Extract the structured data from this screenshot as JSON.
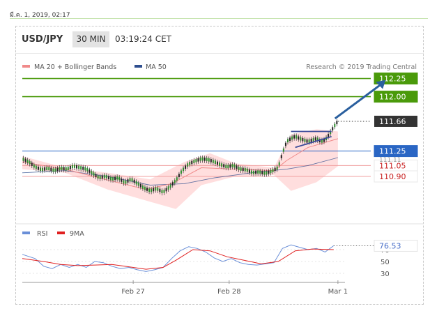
{
  "header": {
    "timestamp": "มี.ค. 1, 2019, 02:17",
    "symbol": "USD/JPY",
    "interval": "30 MIN",
    "time": "03:19:24 CET"
  },
  "legend": {
    "ma20_label": "MA 20 + Bollinger Bands",
    "ma50_label": "MA 50",
    "credit": "Research © 2019 Trading Central",
    "rsi_label": "RSI",
    "ma9_label": "9MA"
  },
  "colors": {
    "ma20": "#f08a8a",
    "ma50": "#2e4e8f",
    "bands": "#ffd8d8",
    "green_level": "#4a9a0a",
    "blue_level": "#2a66c4",
    "red_level": "#f0a0a0",
    "arrow": "#2a5f9e",
    "rsi": "#6a8fd8",
    "ma9": "#e02020"
  },
  "chart_data": [
    {
      "type": "line",
      "name": "price",
      "x_ticks": [
        "Feb 27",
        "Feb 28",
        "Mar 1"
      ],
      "current_price": 111.66,
      "levels": [
        {
          "value": 112.25,
          "label": "112.25",
          "kind": "resistance"
        },
        {
          "value": 112.0,
          "label": "112.00",
          "kind": "resistance"
        },
        {
          "value": 111.25,
          "label": "111.25",
          "kind": "pivot"
        },
        {
          "value": 111.05,
          "label": "111.05",
          "kind": "support"
        },
        {
          "value": 110.9,
          "label": "110.90",
          "kind": "support"
        }
      ],
      "hidden_label": "111.11",
      "price_path": [
        [
          0,
          111.14
        ],
        [
          3,
          111.1
        ],
        [
          6,
          111.03
        ],
        [
          9,
          110.99
        ],
        [
          12,
          111.01
        ],
        [
          15,
          110.98
        ],
        [
          18,
          111.01
        ],
        [
          21,
          111.0
        ],
        [
          24,
          111.04
        ],
        [
          27,
          111.02
        ],
        [
          30,
          111.0
        ],
        [
          33,
          110.94
        ],
        [
          36,
          110.88
        ],
        [
          39,
          110.9
        ],
        [
          42,
          110.86
        ],
        [
          45,
          110.88
        ],
        [
          48,
          110.81
        ],
        [
          51,
          110.86
        ],
        [
          54,
          110.8
        ],
        [
          57,
          110.74
        ],
        [
          60,
          110.7
        ],
        [
          63,
          110.73
        ],
        [
          66,
          110.68
        ],
        [
          69,
          110.75
        ],
        [
          72,
          110.84
        ],
        [
          75,
          110.98
        ],
        [
          78,
          111.07
        ],
        [
          81,
          111.11
        ],
        [
          84,
          111.14
        ],
        [
          87,
          111.13
        ],
        [
          90,
          111.1
        ],
        [
          93,
          111.06
        ],
        [
          96,
          111.03
        ],
        [
          99,
          111.05
        ],
        [
          102,
          111.0
        ],
        [
          105,
          110.99
        ],
        [
          108,
          110.95
        ],
        [
          111,
          110.96
        ],
        [
          114,
          110.94
        ],
        [
          117,
          110.97
        ],
        [
          120,
          111.02
        ],
        [
          122,
          111.22
        ],
        [
          124,
          111.38
        ],
        [
          126,
          111.42
        ],
        [
          128,
          111.45
        ],
        [
          130,
          111.42
        ],
        [
          132,
          111.4
        ],
        [
          134,
          111.38
        ],
        [
          136,
          111.4
        ],
        [
          138,
          111.42
        ],
        [
          140,
          111.38
        ],
        [
          142,
          111.4
        ],
        [
          144,
          111.48
        ],
        [
          146,
          111.58
        ],
        [
          148,
          111.66
        ]
      ],
      "ma20": [
        [
          0,
          111.1
        ],
        [
          20,
          111.0
        ],
        [
          40,
          110.85
        ],
        [
          58,
          110.72
        ],
        [
          70,
          110.8
        ],
        [
          84,
          111.02
        ],
        [
          100,
          111.0
        ],
        [
          118,
          110.98
        ],
        [
          124,
          111.12
        ],
        [
          134,
          111.3
        ],
        [
          148,
          111.42
        ]
      ],
      "ma50": [
        [
          0,
          110.95
        ],
        [
          20,
          110.98
        ],
        [
          40,
          110.9
        ],
        [
          60,
          110.78
        ],
        [
          76,
          110.8
        ],
        [
          90,
          110.88
        ],
        [
          110,
          110.96
        ],
        [
          124,
          111.0
        ],
        [
          134,
          111.05
        ],
        [
          148,
          111.16
        ]
      ],
      "band_upper": [
        [
          0,
          111.18
        ],
        [
          20,
          111.02
        ],
        [
          40,
          110.95
        ],
        [
          60,
          110.86
        ],
        [
          76,
          111.1
        ],
        [
          88,
          111.22
        ],
        [
          100,
          111.08
        ],
        [
          118,
          111.02
        ],
        [
          126,
          111.48
        ],
        [
          138,
          111.55
        ],
        [
          148,
          111.52
        ]
      ],
      "band_lower": [
        [
          0,
          111.0
        ],
        [
          20,
          110.95
        ],
        [
          40,
          110.72
        ],
        [
          60,
          110.55
        ],
        [
          72,
          110.45
        ],
        [
          84,
          110.78
        ],
        [
          100,
          110.9
        ],
        [
          118,
          110.92
        ],
        [
          126,
          110.7
        ],
        [
          138,
          110.82
        ],
        [
          148,
          111.04
        ]
      ],
      "triangle": {
        "top": 111.52,
        "bottom_left": 111.3,
        "bottom_right": 111.45,
        "x_start": 126,
        "x_end": 145
      },
      "arrow": {
        "from": [
          146,
          111.66
        ],
        "to": [
          154,
          112.25
        ]
      }
    },
    {
      "type": "line",
      "name": "rsi",
      "current_value": 76.53,
      "y_ticks": [
        70,
        50,
        30
      ],
      "rsi": [
        [
          0,
          62
        ],
        [
          6,
          55
        ],
        [
          10,
          42
        ],
        [
          14,
          38
        ],
        [
          18,
          45
        ],
        [
          22,
          40
        ],
        [
          26,
          45
        ],
        [
          30,
          40
        ],
        [
          34,
          50
        ],
        [
          38,
          48
        ],
        [
          42,
          42
        ],
        [
          46,
          38
        ],
        [
          50,
          40
        ],
        [
          54,
          36
        ],
        [
          58,
          33
        ],
        [
          62,
          36
        ],
        [
          66,
          40
        ],
        [
          70,
          55
        ],
        [
          74,
          68
        ],
        [
          78,
          75
        ],
        [
          82,
          72
        ],
        [
          86,
          66
        ],
        [
          90,
          56
        ],
        [
          94,
          50
        ],
        [
          98,
          55
        ],
        [
          102,
          48
        ],
        [
          106,
          45
        ],
        [
          110,
          44
        ],
        [
          114,
          46
        ],
        [
          118,
          48
        ],
        [
          122,
          72
        ],
        [
          126,
          78
        ],
        [
          130,
          74
        ],
        [
          134,
          70
        ],
        [
          138,
          72
        ],
        [
          142,
          66
        ],
        [
          146,
          76.53
        ]
      ],
      "ma9": [
        [
          0,
          55
        ],
        [
          10,
          50
        ],
        [
          18,
          45
        ],
        [
          26,
          43
        ],
        [
          34,
          44
        ],
        [
          42,
          45
        ],
        [
          50,
          41
        ],
        [
          58,
          37
        ],
        [
          66,
          40
        ],
        [
          72,
          52
        ],
        [
          80,
          70
        ],
        [
          88,
          68
        ],
        [
          96,
          58
        ],
        [
          104,
          52
        ],
        [
          112,
          46
        ],
        [
          120,
          50
        ],
        [
          128,
          68
        ],
        [
          136,
          71
        ],
        [
          146,
          70
        ]
      ]
    }
  ]
}
